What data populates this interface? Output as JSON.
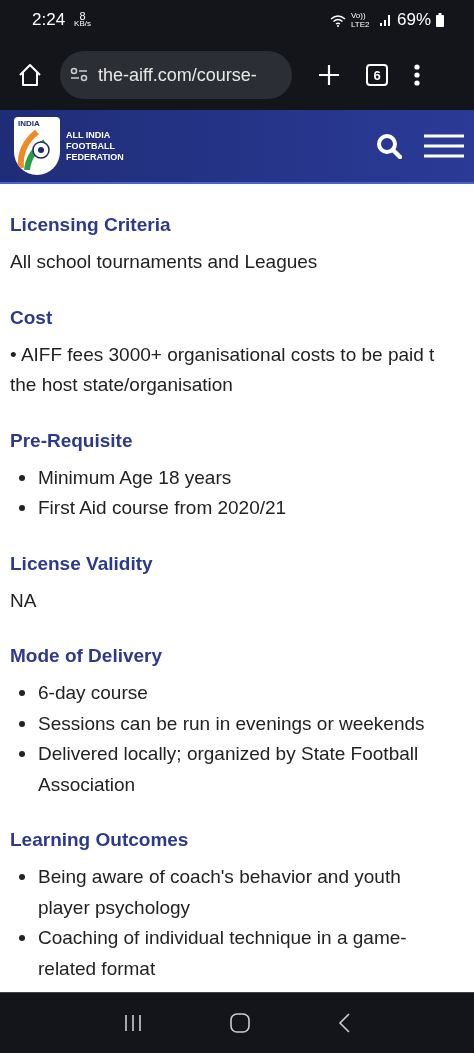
{
  "status_bar": {
    "time": "2:24",
    "speed_value": "8",
    "speed_unit": "KB/s",
    "network": "Vo)) LTE2",
    "battery": "69%"
  },
  "browser": {
    "url": "the-aiff.com/course-",
    "tab_count": "6"
  },
  "site_header": {
    "logo_badge": "INDIA",
    "logo_text": [
      "ALL INDIA",
      "FOOTBALL",
      "FEDERATION"
    ]
  },
  "sections": [
    {
      "heading": "Licensing Criteria",
      "kind": "text",
      "lines": [
        "All school tournaments and Leagues"
      ]
    },
    {
      "heading": "Cost",
      "kind": "text",
      "lines": [
        "• AIFF fees 3000+ organisational costs to be paid t",
        "the host state/organisation"
      ]
    },
    {
      "heading": "Pre-Requisite",
      "kind": "list",
      "items": [
        [
          "Minimum Age 18 years"
        ],
        [
          "First Aid course from 2020/21"
        ]
      ]
    },
    {
      "heading": "License Validity",
      "kind": "text",
      "lines": [
        "NA"
      ]
    },
    {
      "heading": "Mode of Delivery",
      "kind": "list",
      "items": [
        [
          "6-day course"
        ],
        [
          "Sessions can be run in evenings or weekends"
        ],
        [
          "Delivered locally; organized by State Football",
          "Association"
        ]
      ]
    },
    {
      "heading": "Learning Outcomes",
      "kind": "list",
      "items": [
        [
          "Being aware of coach's behavior and youth",
          "player psychology"
        ],
        [
          "Coaching of individual technique in a game-",
          "related format"
        ]
      ]
    }
  ]
}
